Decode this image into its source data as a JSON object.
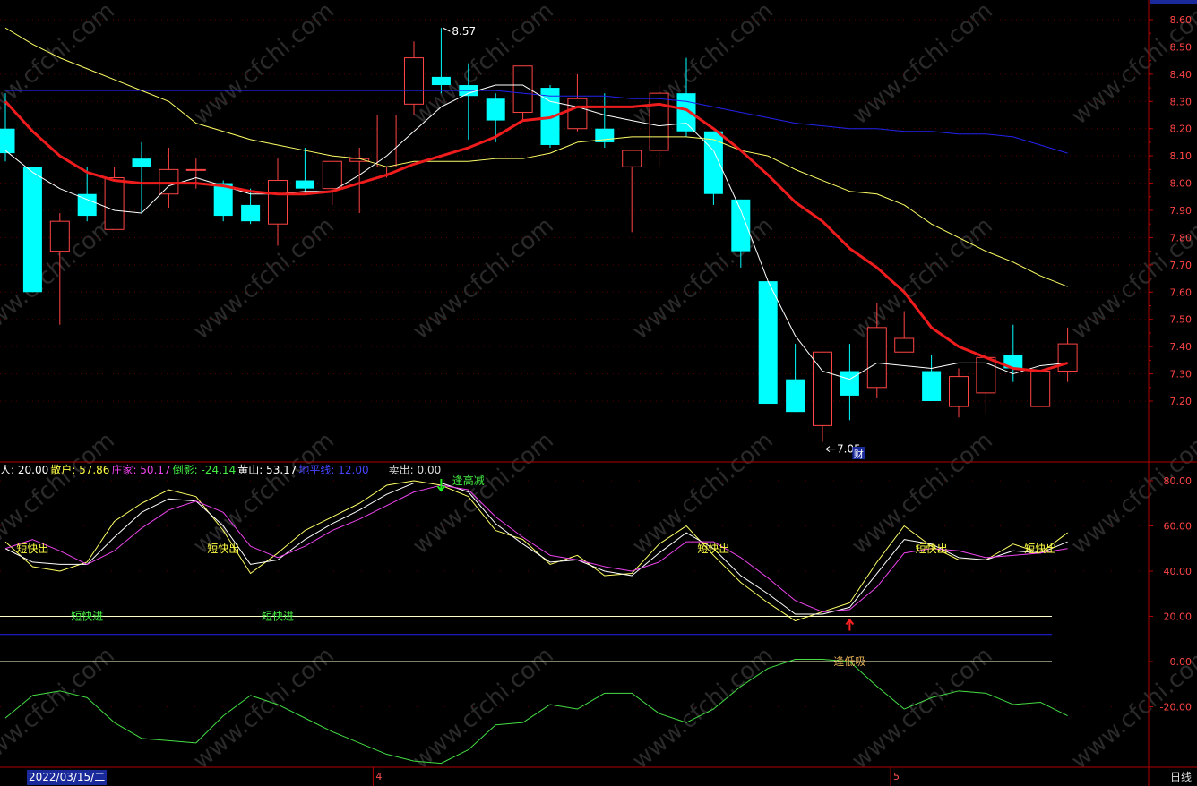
{
  "chart_data": {
    "type": "candlestick",
    "main_axis": {
      "ylim": [
        7.05,
        8.62
      ],
      "ticks": [
        "8.60",
        "8.50",
        "8.40",
        "8.30",
        "8.20",
        "8.10",
        "8.00",
        "7.90",
        "7.80",
        "7.70",
        "7.60",
        "7.50",
        "7.40",
        "7.30",
        "7.20"
      ]
    },
    "candles": [
      {
        "o": 8.2,
        "c": 8.11,
        "h": 8.33,
        "l": 8.08
      },
      {
        "o": 8.06,
        "c": 7.6,
        "h": 8.06,
        "l": 7.6
      },
      {
        "o": 7.75,
        "c": 7.86,
        "h": 7.89,
        "l": 7.48
      },
      {
        "o": 7.96,
        "c": 7.88,
        "h": 8.06,
        "l": 7.86
      },
      {
        "o": 7.83,
        "c": 8.02,
        "h": 8.06,
        "l": 7.83
      },
      {
        "o": 8.09,
        "c": 8.06,
        "h": 8.15,
        "l": 7.89
      },
      {
        "o": 7.96,
        "c": 8.05,
        "h": 8.13,
        "l": 7.91
      },
      {
        "o": 8.05,
        "c": 8.05,
        "h": 8.09,
        "l": 7.98
      },
      {
        "o": 8.0,
        "c": 7.88,
        "h": 8.01,
        "l": 7.86
      },
      {
        "o": 7.92,
        "c": 7.86,
        "h": 7.98,
        "l": 7.85
      },
      {
        "o": 7.85,
        "c": 8.01,
        "h": 8.09,
        "l": 7.77
      },
      {
        "o": 8.01,
        "c": 7.98,
        "h": 8.13,
        "l": 7.96
      },
      {
        "o": 7.98,
        "c": 8.08,
        "h": 8.08,
        "l": 7.92
      },
      {
        "o": 8.08,
        "c": 8.09,
        "h": 8.13,
        "l": 7.89
      },
      {
        "o": 8.06,
        "c": 8.25,
        "h": 8.25,
        "l": 8.02
      },
      {
        "o": 8.29,
        "c": 8.46,
        "h": 8.52,
        "l": 8.25
      },
      {
        "o": 8.39,
        "c": 8.36,
        "h": 8.57,
        "l": 8.33
      },
      {
        "o": 8.36,
        "c": 8.32,
        "h": 8.44,
        "l": 8.16
      },
      {
        "o": 8.31,
        "c": 8.23,
        "h": 8.33,
        "l": 8.15
      },
      {
        "o": 8.26,
        "c": 8.43,
        "h": 8.43,
        "l": 8.23
      },
      {
        "o": 8.35,
        "c": 8.14,
        "h": 8.36,
        "l": 8.13
      },
      {
        "o": 8.2,
        "c": 8.31,
        "h": 8.4,
        "l": 8.19
      },
      {
        "o": 8.2,
        "c": 8.15,
        "h": 8.33,
        "l": 8.13
      },
      {
        "o": 8.06,
        "c": 8.12,
        "h": 8.12,
        "l": 7.82
      },
      {
        "o": 8.12,
        "c": 8.33,
        "h": 8.36,
        "l": 8.06
      },
      {
        "o": 8.33,
        "c": 8.19,
        "h": 8.46,
        "l": 8.17
      },
      {
        "o": 8.19,
        "c": 7.96,
        "h": 8.19,
        "l": 7.92
      },
      {
        "o": 7.94,
        "c": 7.75,
        "h": 7.94,
        "l": 7.69
      },
      {
        "o": 7.64,
        "c": 7.19,
        "h": 7.64,
        "l": 7.19
      },
      {
        "o": 7.28,
        "c": 7.16,
        "h": 7.41,
        "l": 7.16
      },
      {
        "o": 7.11,
        "c": 7.38,
        "h": 7.38,
        "l": 7.05
      },
      {
        "o": 7.31,
        "c": 7.22,
        "h": 7.41,
        "l": 7.13
      },
      {
        "o": 7.25,
        "c": 7.47,
        "h": 7.56,
        "l": 7.21
      },
      {
        "o": 7.38,
        "c": 7.43,
        "h": 7.53,
        "l": 7.38
      },
      {
        "o": 7.31,
        "c": 7.2,
        "h": 7.37,
        "l": 7.2
      },
      {
        "o": 7.18,
        "c": 7.29,
        "h": 7.32,
        "l": 7.14
      },
      {
        "o": 7.23,
        "c": 7.36,
        "h": 7.38,
        "l": 7.15
      },
      {
        "o": 7.37,
        "c": 7.32,
        "h": 7.48,
        "l": 7.27
      },
      {
        "o": 7.18,
        "c": 7.31,
        "h": 7.31,
        "l": 7.18
      },
      {
        "o": 7.31,
        "c": 7.41,
        "h": 7.47,
        "l": 7.27
      }
    ],
    "ma_lines": [
      {
        "color": "#ffffff",
        "width": 1,
        "values": [
          8.12,
          8.04,
          7.98,
          7.94,
          7.9,
          7.89,
          7.99,
          8.02,
          7.99,
          7.96,
          7.96,
          7.97,
          7.97,
          8.03,
          8.1,
          8.19,
          8.28,
          8.33,
          8.36,
          8.36,
          8.3,
          8.28,
          8.25,
          8.23,
          8.21,
          8.22,
          8.12,
          7.9,
          7.64,
          7.44,
          7.31,
          7.28,
          7.34,
          7.33,
          7.32,
          7.34,
          7.34,
          7.3,
          7.33,
          7.34
        ]
      },
      {
        "color": "#ee1c1c",
        "width": 3,
        "values": [
          8.3,
          8.19,
          8.1,
          8.04,
          8.01,
          8.0,
          8.0,
          8.0,
          7.99,
          7.97,
          7.96,
          7.96,
          7.97,
          8.0,
          8.03,
          8.07,
          8.1,
          8.13,
          8.17,
          8.23,
          8.24,
          8.28,
          8.28,
          8.28,
          8.29,
          8.27,
          8.2,
          8.12,
          8.03,
          7.93,
          7.86,
          7.76,
          7.69,
          7.6,
          7.47,
          7.4,
          7.36,
          7.32,
          7.31,
          7.34
        ]
      },
      {
        "color": "#ffff66",
        "width": 1,
        "values": [
          8.57,
          8.51,
          8.46,
          8.42,
          8.38,
          8.34,
          8.3,
          8.22,
          8.19,
          8.16,
          8.14,
          8.12,
          8.1,
          8.09,
          8.06,
          8.08,
          8.08,
          8.08,
          8.09,
          8.09,
          8.11,
          8.15,
          8.16,
          8.17,
          8.17,
          8.17,
          8.16,
          8.12,
          8.1,
          8.05,
          8.01,
          7.97,
          7.96,
          7.92,
          7.85,
          7.8,
          7.75,
          7.71,
          7.66,
          7.62
        ]
      },
      {
        "color": "#2222ee",
        "width": 1,
        "values": [
          8.34,
          8.34,
          8.34,
          8.34,
          8.34,
          8.34,
          8.34,
          8.34,
          8.34,
          8.34,
          8.34,
          8.34,
          8.34,
          8.34,
          8.34,
          8.34,
          8.34,
          8.34,
          8.34,
          8.33,
          8.32,
          8.32,
          8.32,
          8.31,
          8.31,
          8.3,
          8.28,
          8.26,
          8.24,
          8.22,
          8.21,
          8.2,
          8.2,
          8.19,
          8.19,
          8.18,
          8.18,
          8.17,
          8.14,
          8.11
        ]
      }
    ],
    "price_annotations": [
      {
        "index": 16,
        "value": 8.57,
        "text": "8.57",
        "dir": "right"
      },
      {
        "index": 30,
        "value": 7.05,
        "text": "7.05",
        "dir": "left"
      }
    ],
    "event_marker": {
      "index": 31,
      "text": "财"
    },
    "indicator": {
      "title_items": [
        {
          "text": "人: 20.00",
          "color": "#ffffff"
        },
        {
          "text": "散户: 57.86",
          "color": "#ffff44"
        },
        {
          "text": "庄家: 50.17",
          "color": "#ee44ee"
        },
        {
          "text": "倒影: -24.14",
          "color": "#44ee44"
        },
        {
          "text": "黄山: 53.17",
          "color": "#ffffff"
        },
        {
          "text": "地平线: 12.00",
          "color": "#4444ff"
        },
        {
          "text": "卖出: 0.00",
          "color": "#dddddd"
        }
      ],
      "ylim": [
        -38,
        90
      ],
      "ticks": [
        "80.00",
        "60.00",
        "40.00",
        "20.00",
        "0.00",
        "-20.00"
      ],
      "hlines": [
        {
          "value": 20,
          "color": "#ffffcc"
        },
        {
          "value": 12,
          "color": "#2222ee"
        },
        {
          "value": 0,
          "color": "#ffffcc"
        }
      ],
      "series": [
        {
          "color": "#ffff66",
          "values": [
            53,
            42,
            40,
            44,
            62,
            70,
            76,
            73,
            58,
            39,
            48,
            58,
            64,
            70,
            78,
            80,
            78,
            73,
            58,
            54,
            43,
            47,
            38,
            39,
            52,
            60,
            47,
            35,
            26,
            18,
            22,
            26,
            44,
            60,
            51,
            45,
            45,
            52,
            48,
            57
          ]
        },
        {
          "color": "#ffffff",
          "values": [
            50,
            44,
            43,
            43,
            55,
            66,
            72,
            71,
            60,
            43,
            45,
            54,
            61,
            67,
            74,
            79,
            79,
            75,
            61,
            52,
            44,
            45,
            40,
            38,
            48,
            57,
            50,
            38,
            30,
            21,
            21,
            24,
            39,
            54,
            52,
            46,
            45,
            49,
            48,
            53
          ]
        },
        {
          "color": "#ee44ee",
          "values": [
            50,
            54,
            49,
            43,
            49,
            59,
            67,
            71,
            66,
            51,
            46,
            51,
            58,
            63,
            69,
            75,
            78,
            76,
            64,
            55,
            47,
            45,
            42,
            40,
            44,
            53,
            53,
            46,
            37,
            27,
            22,
            23,
            33,
            48,
            50,
            49,
            46,
            47,
            48,
            50
          ]
        },
        {
          "color": "#44dd44",
          "values": [
            -25,
            -15,
            -13,
            -16,
            -27,
            -34,
            -35,
            -36,
            -24,
            -15,
            -19,
            -25,
            -31,
            -36,
            -41,
            -44,
            -45,
            -39,
            -28,
            -27,
            -19,
            -21,
            -14,
            -14,
            -23,
            -27,
            -21,
            -11,
            -3,
            1,
            1,
            0,
            -11,
            -21,
            -16,
            -13,
            -14,
            -19,
            -18,
            -24
          ]
        }
      ],
      "labels": [
        {
          "index": 1,
          "value": 50,
          "text": "短快出",
          "color": "#ffff44"
        },
        {
          "index": 3,
          "value": 20,
          "text": "短快进",
          "color": "#44ee44"
        },
        {
          "index": 8,
          "value": 50,
          "text": "短快出",
          "color": "#ffff44"
        },
        {
          "index": 10,
          "value": 20,
          "text": "短快进",
          "color": "#44ee44"
        },
        {
          "index": 17,
          "value": 80,
          "text": "逢高减",
          "color": "#44ee44"
        },
        {
          "index": 26,
          "value": 50,
          "text": "短快出",
          "color": "#ffff44"
        },
        {
          "index": 31,
          "value": 0,
          "text": "逢低吸",
          "color": "#ddaa55"
        },
        {
          "index": 34,
          "value": 50,
          "text": "短快出",
          "color": "#ffff44"
        },
        {
          "index": 38,
          "value": 50,
          "text": "短快出",
          "color": "#ffff44"
        }
      ],
      "arrows": [
        {
          "index": 16,
          "dir": "down",
          "color": "#22ee22"
        },
        {
          "index": 31,
          "dir": "up",
          "color": "#ff2222"
        }
      ]
    },
    "x_axis": {
      "date_label": "2022/03/15/二",
      "month_marks": [
        {
          "index": 14,
          "text": "4"
        },
        {
          "index": 33,
          "text": "5"
        }
      ]
    },
    "period": "日线",
    "watermark": "www.cfchi.com"
  }
}
